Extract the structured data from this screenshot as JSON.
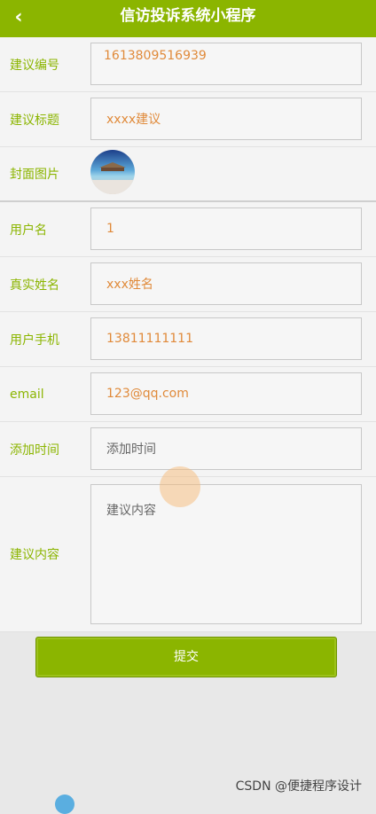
{
  "header": {
    "title": "信访投诉系统小程序",
    "back_icon": "chevron-left-icon"
  },
  "form": {
    "suggestion_number": {
      "label": "建议编号",
      "value": "1613809516939"
    },
    "suggestion_title": {
      "label": "建议标题",
      "value": "xxxx建议"
    },
    "cover_image": {
      "label": "封面图片"
    },
    "username": {
      "label": "用户名",
      "value": "1"
    },
    "real_name": {
      "label": "真实姓名",
      "value": "xxx姓名"
    },
    "phone": {
      "label": "用户手机",
      "value": "13811111111"
    },
    "email": {
      "label": "email",
      "value": "123@qq.com"
    },
    "add_time": {
      "label": "添加时间",
      "placeholder": "添加时间"
    },
    "content": {
      "label": "建议内容",
      "placeholder": "建议内容"
    }
  },
  "submit_label": "提交",
  "watermark": "CSDN @便捷程序设计",
  "colors": {
    "accent": "#8bb500",
    "value_text": "#e08a3a"
  }
}
